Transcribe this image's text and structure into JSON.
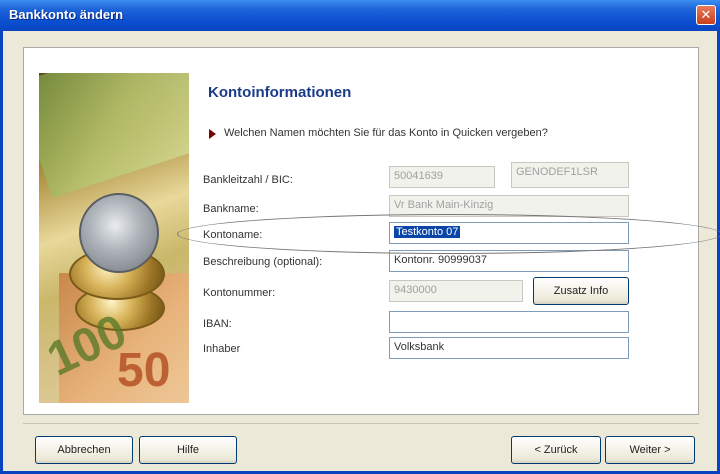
{
  "window": {
    "title": "Bankkonto ändern",
    "close_glyph": "✕"
  },
  "content": {
    "heading": "Kontoinformationen",
    "question": "Welchen Namen möchten Sie für das Konto in Quicken vergeben?"
  },
  "form": {
    "blz_label": "Bankleitzahl / BIC:",
    "blz_value": "50041639",
    "bic_value": "GENODEF1LSR",
    "bankname_label": "Bankname:",
    "bankname_value": "Vr Bank Main-Kinzig",
    "kontoname_label": "Kontoname:",
    "kontoname_value": "Testkonto 07",
    "beschreibung_label": "Beschreibung (optional):",
    "beschreibung_value": "Kontonr. 90999037",
    "kontonummer_label": "Kontonummer:",
    "kontonummer_value": "9430000",
    "zusatz_button": "Zusatz Info",
    "iban_label": "IBAN:",
    "iban_value": "",
    "inhaber_label": "Inhaber",
    "inhaber_value": "Volksbank"
  },
  "buttons": {
    "cancel": "Abbrechen",
    "help": "Hilfe",
    "back": "< Zurück",
    "next": "Weiter >"
  },
  "colors": {
    "titlebar": "#0a4fd0",
    "heading": "#1a3a8a",
    "selection": "#0a46a8"
  }
}
